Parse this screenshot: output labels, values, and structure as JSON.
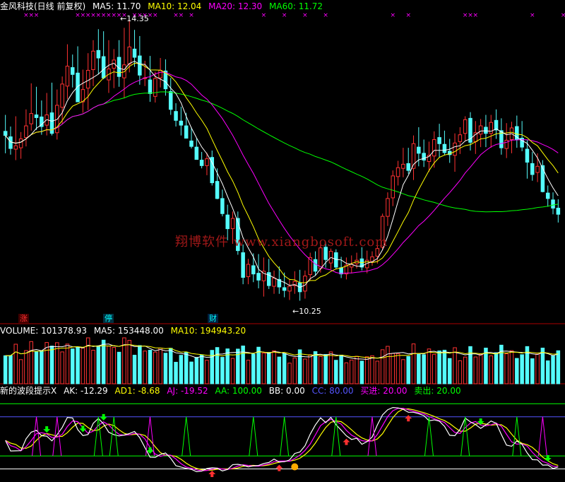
{
  "header": {
    "title": "金风科技(日线 前复权)",
    "ma": [
      {
        "label": "MA5: 11.70",
        "color": "#ffffff"
      },
      {
        "label": "MA10: 12.04",
        "color": "#ffff00"
      },
      {
        "label": "MA20: 12.30",
        "color": "#ff00ff"
      },
      {
        "label": "MA60: 11.72",
        "color": "#00ff00"
      }
    ]
  },
  "price_panel": {
    "high_label": "14.35",
    "low_label": "10.25",
    "watermark": "翔博软件 www.xiangbosoft.com",
    "tags": {
      "zhang": "涨",
      "ting": "停",
      "cai": "财"
    }
  },
  "volume_header": {
    "volume": "VOLUME: 101378.93",
    "ma5": "MA5: 153448.00",
    "ma10": "MA10: 194943.20"
  },
  "indicator_header": {
    "name": "新的波段提示X",
    "ak": "AK: -12.29",
    "ad1": "AD1: -8.68",
    "aj": "AJ: -19.52",
    "aa": "AA: 100.00",
    "bb": "BB: 0.00",
    "cc": "CC: 80.00",
    "buy": "买进: 20.00",
    "sell": "卖出: 20.00"
  },
  "colors": {
    "up": "#ff3232",
    "down": "#54fcfc",
    "ma5": "#ffffff",
    "ma10": "#ffff00",
    "ma20": "#ff00ff",
    "ma60": "#00ff00",
    "divider": "#aa0000"
  },
  "chart_data": {
    "type": "candlestick",
    "title": "金风科技(日线 前复权)",
    "annotations": {
      "max_high": 14.35,
      "min_low": 10.25
    },
    "candles": [
      [
        12.72,
        12.96,
        12.4,
        12.66
      ],
      [
        12.64,
        12.79,
        12.38,
        12.47
      ],
      [
        12.46,
        12.94,
        12.3,
        12.51
      ],
      [
        12.48,
        12.71,
        12.32,
        12.61
      ],
      [
        12.63,
        13.04,
        12.5,
        12.8
      ],
      [
        12.83,
        13.42,
        12.73,
        12.98
      ],
      [
        12.96,
        13.37,
        12.74,
        12.92
      ],
      [
        12.93,
        13.17,
        12.67,
        12.79
      ],
      [
        12.81,
        13.28,
        12.66,
        12.96
      ],
      [
        12.99,
        13.43,
        12.66,
        12.69
      ],
      [
        12.7,
        13.33,
        12.6,
        13.1
      ],
      [
        13.07,
        13.52,
        12.83,
        13.41
      ],
      [
        13.38,
        13.99,
        13.19,
        13.67
      ],
      [
        13.65,
        13.84,
        13.36,
        13.55
      ],
      [
        13.57,
        13.96,
        13.15,
        13.15
      ],
      [
        13.15,
        13.62,
        12.99,
        13.33
      ],
      [
        13.35,
        13.86,
        13.03,
        13.61
      ],
      [
        13.62,
        14.05,
        13.38,
        13.89
      ],
      [
        13.9,
        14.21,
        13.55,
        13.79
      ],
      [
        13.81,
        14.18,
        13.48,
        13.5
      ],
      [
        13.47,
        14.05,
        13.28,
        13.63
      ],
      [
        13.64,
        13.92,
        13.35,
        13.76
      ],
      [
        13.8,
        14.05,
        13.37,
        13.52
      ],
      [
        13.5,
        14.23,
        13.2,
        13.69
      ],
      [
        13.7,
        14.35,
        13.58,
        13.95
      ],
      [
        13.92,
        14.2,
        13.66,
        13.8
      ],
      [
        13.82,
        14.11,
        13.4,
        13.54
      ],
      [
        13.5,
        13.75,
        13.38,
        13.5
      ],
      [
        13.47,
        13.82,
        13.15,
        13.27
      ],
      [
        13.23,
        13.59,
        13.14,
        13.49
      ],
      [
        13.5,
        13.79,
        13.36,
        13.61
      ],
      [
        13.6,
        13.77,
        13.24,
        13.34
      ],
      [
        13.3,
        13.5,
        12.96,
        13.04
      ],
      [
        13.01,
        13.13,
        12.79,
        12.88
      ],
      [
        12.87,
        13.08,
        12.66,
        12.81
      ],
      [
        12.8,
        12.99,
        12.62,
        12.62
      ],
      [
        12.58,
        12.78,
        12.47,
        12.5
      ],
      [
        12.49,
        12.62,
        12.31,
        12.31
      ],
      [
        12.3,
        12.42,
        12.18,
        12.22
      ],
      [
        12.22,
        12.41,
        12.08,
        12.32
      ],
      [
        12.34,
        12.44,
        11.93,
        11.97
      ],
      [
        11.99,
        12.18,
        11.73,
        11.74
      ],
      [
        11.74,
        11.87,
        11.48,
        11.52
      ],
      [
        11.5,
        11.65,
        11.13,
        11.3
      ],
      [
        11.3,
        11.55,
        11.08,
        11.45
      ],
      [
        11.45,
        11.55,
        10.92,
        10.98
      ],
      [
        10.95,
        11.07,
        10.49,
        10.59
      ],
      [
        10.6,
        10.86,
        10.49,
        10.78
      ],
      [
        10.76,
        10.94,
        10.52,
        10.64
      ],
      [
        10.65,
        10.93,
        10.43,
        10.55
      ],
      [
        10.54,
        10.88,
        10.31,
        10.68
      ],
      [
        10.66,
        10.86,
        10.42,
        10.47
      ],
      [
        10.46,
        10.69,
        10.35,
        10.58
      ],
      [
        10.56,
        10.75,
        10.35,
        10.45
      ],
      [
        10.44,
        10.66,
        10.3,
        10.4
      ],
      [
        10.39,
        10.57,
        10.26,
        10.46
      ],
      [
        10.47,
        10.68,
        10.35,
        10.53
      ],
      [
        10.51,
        10.7,
        10.25,
        10.38
      ],
      [
        10.39,
        10.69,
        10.28,
        10.61
      ],
      [
        10.63,
        10.95,
        10.55,
        10.88
      ],
      [
        10.85,
        10.97,
        10.62,
        10.68
      ],
      [
        10.72,
        11.12,
        10.66,
        11.02
      ],
      [
        11.03,
        11.1,
        10.73,
        10.85
      ],
      [
        10.8,
        11.01,
        10.71,
        10.97
      ],
      [
        10.95,
        11.0,
        10.71,
        10.74
      ],
      [
        10.73,
        10.89,
        10.58,
        10.64
      ],
      [
        10.64,
        10.88,
        10.56,
        10.77
      ],
      [
        10.74,
        10.91,
        10.65,
        10.78
      ],
      [
        10.79,
        10.95,
        10.72,
        10.84
      ],
      [
        10.86,
        11.03,
        10.69,
        10.74
      ],
      [
        10.73,
        10.98,
        10.65,
        10.84
      ],
      [
        10.82,
        10.97,
        10.76,
        10.89
      ],
      [
        10.9,
        11.09,
        10.79,
        11.01
      ],
      [
        11.03,
        11.52,
        10.99,
        11.48
      ],
      [
        11.48,
        11.83,
        11.34,
        11.74
      ],
      [
        11.75,
        12.15,
        11.63,
        12.07
      ],
      [
        12.06,
        12.29,
        11.93,
        12.19
      ],
      [
        12.18,
        12.48,
        12.05,
        12.24
      ],
      [
        12.25,
        12.48,
        12.1,
        12.15
      ],
      [
        12.18,
        12.66,
        12.01,
        12.54
      ],
      [
        12.49,
        12.78,
        12.21,
        12.4
      ],
      [
        12.4,
        12.6,
        12.2,
        12.3
      ],
      [
        12.28,
        12.57,
        12.13,
        12.37
      ],
      [
        12.36,
        12.72,
        12.19,
        12.6
      ],
      [
        12.63,
        12.83,
        12.34,
        12.54
      ],
      [
        12.53,
        12.73,
        12.37,
        12.41
      ],
      [
        12.43,
        12.61,
        12.26,
        12.38
      ],
      [
        12.37,
        12.69,
        12.13,
        12.55
      ],
      [
        12.57,
        12.78,
        12.39,
        12.67
      ],
      [
        12.69,
        12.94,
        12.58,
        12.89
      ],
      [
        12.91,
        13.0,
        12.44,
        12.56
      ],
      [
        12.57,
        12.87,
        12.39,
        12.7
      ],
      [
        12.68,
        12.9,
        12.49,
        12.8
      ],
      [
        12.78,
        12.96,
        12.49,
        12.69
      ],
      [
        12.69,
        12.96,
        12.48,
        12.85
      ],
      [
        12.88,
        13.04,
        12.61,
        12.74
      ],
      [
        12.73,
        12.91,
        12.38,
        12.48
      ],
      [
        12.47,
        12.84,
        12.33,
        12.59
      ],
      [
        12.6,
        12.86,
        12.4,
        12.77
      ],
      [
        12.79,
        12.95,
        12.48,
        12.6
      ],
      [
        12.62,
        12.87,
        12.43,
        12.49
      ],
      [
        12.46,
        12.59,
        12.03,
        12.27
      ],
      [
        12.25,
        12.42,
        12.0,
        12.09
      ],
      [
        12.12,
        12.4,
        11.98,
        12.21
      ],
      [
        12.22,
        12.3,
        11.83,
        11.84
      ],
      [
        11.82,
        11.93,
        11.62,
        11.74
      ],
      [
        11.72,
        11.83,
        11.51,
        11.6
      ],
      [
        11.6,
        11.73,
        11.39,
        11.51
      ]
    ],
    "ma5_last": 11.7,
    "ma10_last": 12.04,
    "ma20_last": 12.3,
    "ma60_last": 11.72,
    "volume": {
      "last": 101378.93,
      "ma5": 153448.0,
      "ma10": 194943.2
    },
    "indicator": {
      "name": "新的波段提示X",
      "AK": -12.29,
      "AD1": -8.68,
      "AJ": -19.52,
      "AA": 100.0,
      "BB": 0.0,
      "CC": 80.0,
      "buy": 20.0,
      "sell": 20.0
    }
  }
}
